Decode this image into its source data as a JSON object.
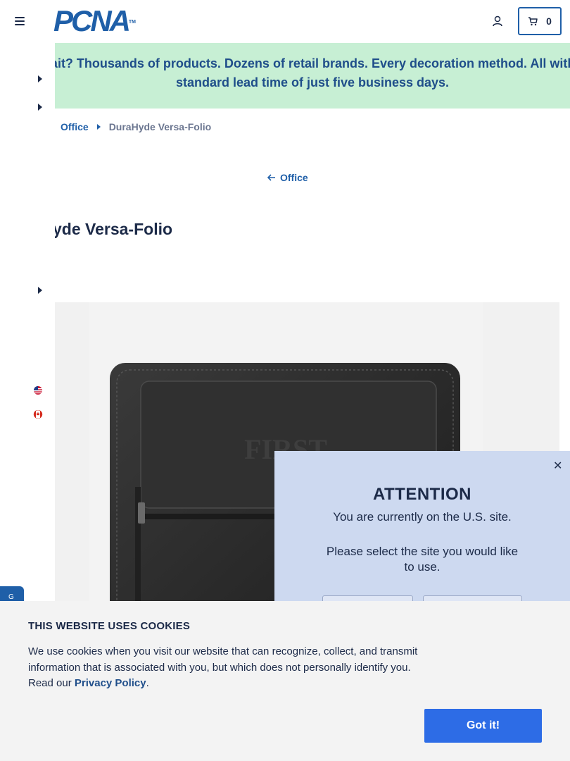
{
  "header": {
    "logo_text": "PCNA",
    "logo_tm": "TM",
    "cart_count": "0"
  },
  "banner": {
    "text": "Wait? Thousands of products. Dozens of retail brands. Every decoration method. All with a standard lead time of just five business days."
  },
  "breadcrumb": {
    "items": [
      "Office",
      "DuraHyde Versa-Folio"
    ]
  },
  "back_link": {
    "label": "Office"
  },
  "product": {
    "title": "DuraHyde Versa-Folio",
    "emboss_text": "FIRST"
  },
  "modal": {
    "title": "ATTENTION",
    "line1": "You are currently on the U.S. site.",
    "line2": "Please select the site you would like to use."
  },
  "side_tab": {
    "label": "G"
  },
  "cookie": {
    "title": "THIS WEBSITE USES COOKIES",
    "text": "We use cookies when you visit our website that can recognize, collect, and transmit information that is associated with you, but which does not personally identify you. Read our ",
    "link": "Privacy Policy",
    "end": ".",
    "button": "Got it!"
  },
  "colors": {
    "brand_blue": "#1f5fa8",
    "banner_green": "#c7efd4",
    "modal_bg": "#cdd9f0",
    "cookie_button": "#2d6ce6"
  }
}
